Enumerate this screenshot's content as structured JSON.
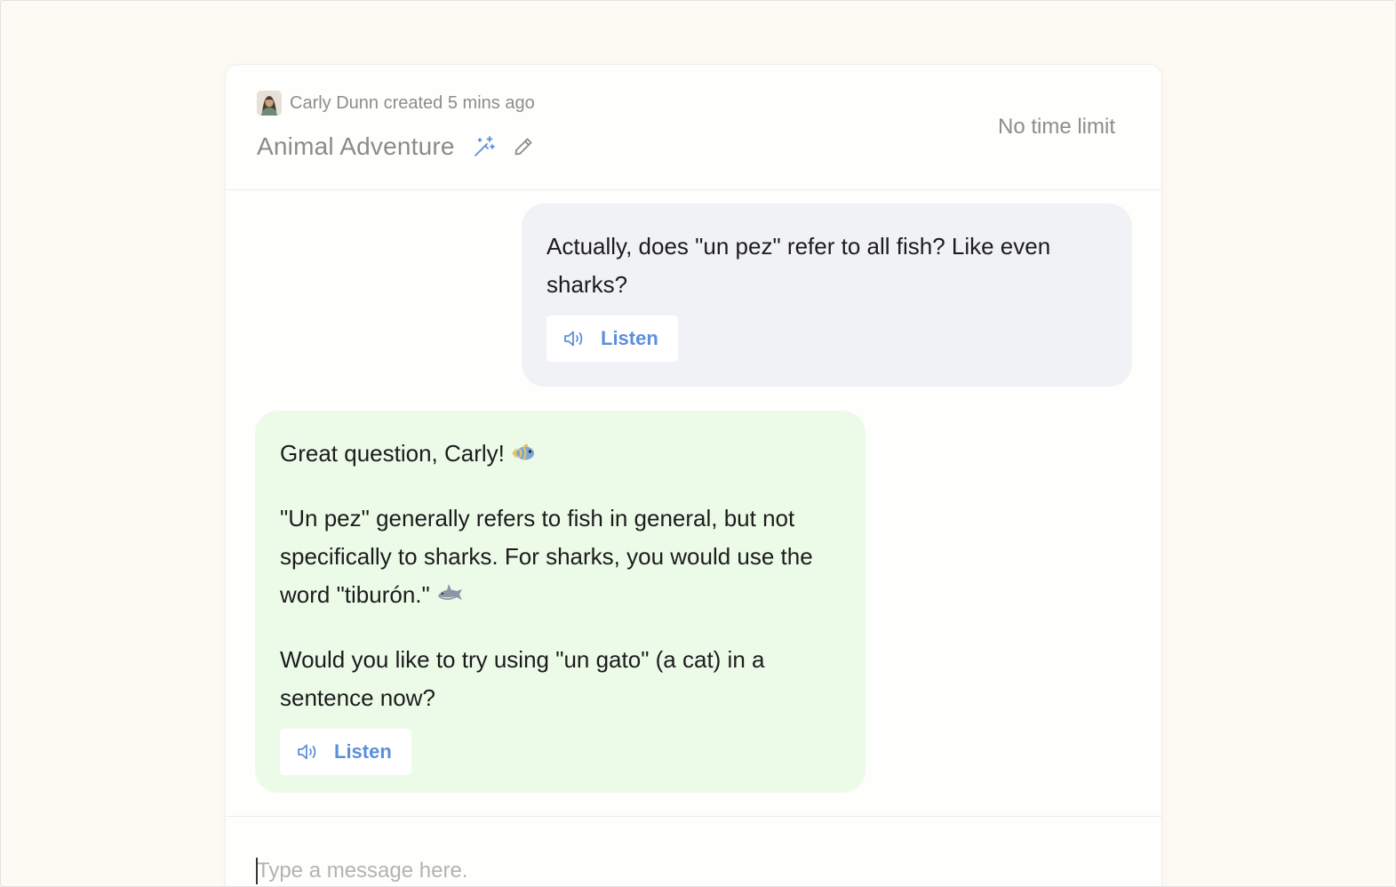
{
  "header": {
    "creator_text": "Carly Dunn created 5 mins ago",
    "title": "Animal Adventure",
    "time_limit": "No time limit"
  },
  "messages": {
    "user": {
      "text": "Actually, does \"un pez\" refer to all fish? Like even sharks?",
      "listen_label": "Listen"
    },
    "assistant": {
      "paragraph_1": "Great question, Carly!",
      "paragraph_1_emoji": "fish-emoji",
      "paragraph_2": "\"Un pez\" generally refers to fish in general, but not specifically to sharks. For sharks, you would use the word \"tiburón.\"",
      "paragraph_2_emoji": "shark-emoji",
      "paragraph_3": "Would you like to try using \"un gato\" (a cat) in a sentence now?",
      "listen_label": "Listen"
    }
  },
  "composer": {
    "placeholder": "Type a message here.",
    "value": ""
  },
  "colors": {
    "page_background": "#fdfaf3",
    "user_bubble": "#f1f2f5",
    "assistant_bubble": "#ecfbe8",
    "accent": "#5b8fdb",
    "muted_text": "#8d8d8d"
  }
}
